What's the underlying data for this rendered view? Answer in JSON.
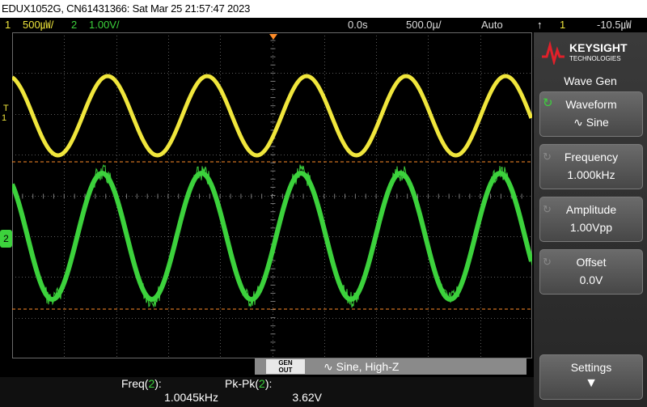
{
  "titlebar": {
    "text": "EDUX1052G, CN61431366: Sat Mar 25 21:57:47 2023"
  },
  "status": {
    "ch1_num": "1",
    "ch1_scale": "500㎼/",
    "ch2_num": "2",
    "ch2_scale": "1.00V/",
    "time_delay": "0.0s",
    "time_scale": "500.0µ/",
    "trigger_mode": "Auto",
    "trigger_ch": "1",
    "trigger_level": "-10.5㎼"
  },
  "screen": {
    "ch1_marker": "1",
    "ch2_marker": "2",
    "trigger_T": "T"
  },
  "panel": {
    "logo_line1": "KEYSIGHT",
    "logo_line2": "TECHNOLOGIES",
    "title": "Wave Gen",
    "softkeys": [
      {
        "label": "Waveform",
        "value": "Sine",
        "icon": "sine-icon"
      },
      {
        "label": "Frequency",
        "value": "1.000kHz"
      },
      {
        "label": "Amplitude",
        "value": "1.00Vpp"
      },
      {
        "label": "Offset",
        "value": "0.0V"
      }
    ],
    "settings_label": "Settings"
  },
  "genbar": {
    "badge_line1": "GEN",
    "badge_line2": "OUT",
    "text": "Sine, High-Z"
  },
  "measurements": [
    {
      "name": "Freq",
      "ch": "2",
      "value": "1.0045kHz"
    },
    {
      "name": "Pk-Pk",
      "ch": "2",
      "value": "3.62V"
    }
  ],
  "colors": {
    "ch1": "#f0e63c",
    "ch2": "#3cd23c",
    "grid": "#5a5a5a",
    "cursor": "#ff8c28"
  }
}
